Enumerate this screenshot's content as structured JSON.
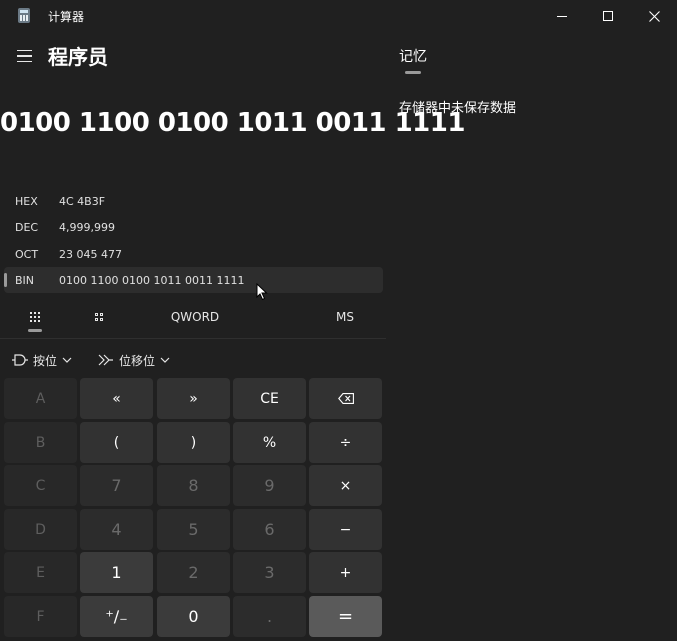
{
  "window": {
    "title": "计算器",
    "minimize_icon": "minimize-icon",
    "maximize_icon": "maximize-icon",
    "close_icon": "close-icon"
  },
  "header": {
    "menu_icon": "hamburger-menu-icon",
    "mode": "程序员"
  },
  "display": {
    "value": "0100 1100 0100 1011 0011 1111"
  },
  "radix": [
    {
      "label": "HEX",
      "value": "4C 4B3F"
    },
    {
      "label": "DEC",
      "value": "4,999,999"
    },
    {
      "label": "OCT",
      "value": "23 045 477"
    },
    {
      "label": "BIN",
      "value": "0100 1100 0100 1011 0011 1111",
      "selected": true
    }
  ],
  "toolbar": {
    "full_keypad_icon": "full-keypad-icon",
    "bit_toggle_icon": "bit-toggling-keypad-icon",
    "word_size": "QWORD",
    "memory_store": "MS"
  },
  "bit_ops": {
    "bitwise_label": "按位",
    "shift_label": "位移位"
  },
  "keypad": [
    [
      "A",
      "«",
      "»",
      "CE",
      "⌫"
    ],
    [
      "B",
      "(",
      ")",
      "%",
      "÷"
    ],
    [
      "C",
      "7",
      "8",
      "9",
      "×"
    ],
    [
      "D",
      "4",
      "5",
      "6",
      "−"
    ],
    [
      "E",
      "1",
      "2",
      "3",
      "+"
    ],
    [
      "F",
      "⁺∕₋",
      "0",
      ".",
      "="
    ]
  ],
  "memory": {
    "title": "记忆",
    "empty_message": "存储器中未保存数据"
  },
  "colors": {
    "background": "#202020",
    "key_function": "#323232",
    "key_number": "#3b3b3b",
    "key_disabled": "#282828",
    "key_equals": "#5a5a5a"
  }
}
